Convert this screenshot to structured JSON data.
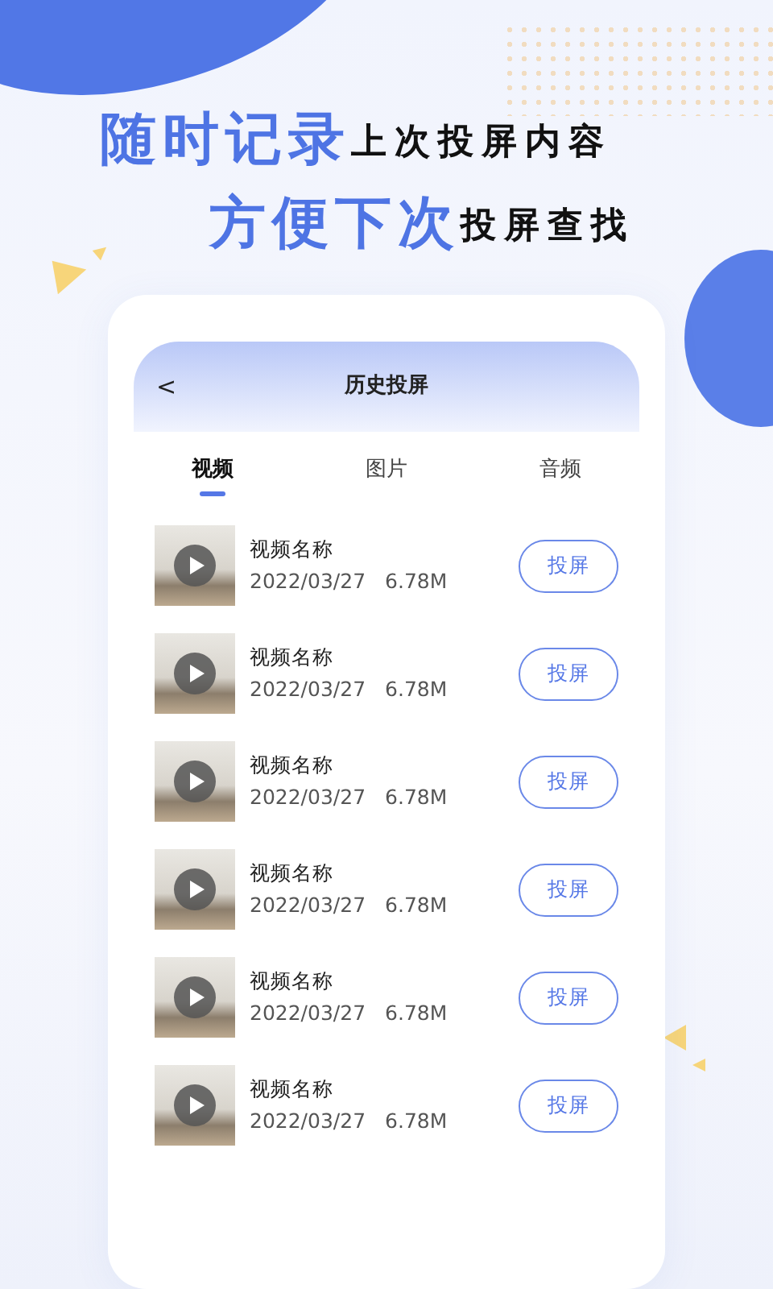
{
  "headline": [
    {
      "parts": [
        {
          "text": "随时记录",
          "kind": "accent"
        },
        {
          "text": "上次投屏内容",
          "kind": "plain"
        }
      ]
    },
    {
      "parts": [
        {
          "text": "方便下次",
          "kind": "accent"
        },
        {
          "text": "投屏查找",
          "kind": "plain"
        }
      ]
    }
  ],
  "screen": {
    "back": "<",
    "title": "历史投屏",
    "tabs": [
      {
        "label": "视频",
        "selected": true
      },
      {
        "label": "图片",
        "selected": false
      },
      {
        "label": "音频",
        "selected": false
      }
    ],
    "items": [
      {
        "name": "视频名称",
        "date": "2022/03/27",
        "size": "6.78M",
        "action": "投屏"
      },
      {
        "name": "视频名称",
        "date": "2022/03/27",
        "size": "6.78M",
        "action": "投屏"
      },
      {
        "name": "视频名称",
        "date": "2022/03/27",
        "size": "6.78M",
        "action": "投屏"
      },
      {
        "name": "视频名称",
        "date": "2022/03/27",
        "size": "6.78M",
        "action": "投屏"
      },
      {
        "name": "视频名称",
        "date": "2022/03/27",
        "size": "6.78M",
        "action": "投屏"
      },
      {
        "name": "视频名称",
        "date": "2022/03/27",
        "size": "6.78M",
        "action": "投屏"
      }
    ]
  }
}
